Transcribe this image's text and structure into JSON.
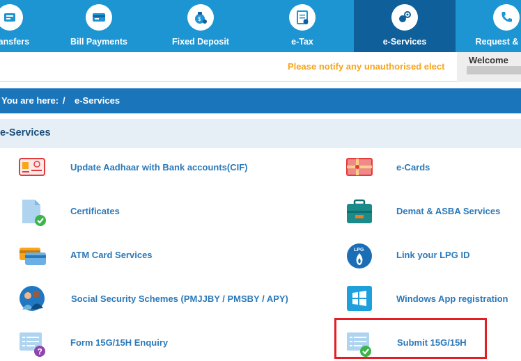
{
  "nav": {
    "items": [
      {
        "label": "Transfers"
      },
      {
        "label": "Bill Payments"
      },
      {
        "label": "Fixed Deposit"
      },
      {
        "label": "e-Tax"
      },
      {
        "label": "e-Services"
      },
      {
        "label": "Request & Enq"
      }
    ],
    "active": "e-Services",
    "colors": {
      "bar": "#1d95d2",
      "active": "#0f5f9b"
    }
  },
  "notice": {
    "text": "Please notify any unauthorised elect",
    "color": "#f7a51b"
  },
  "welcome": {
    "label": "Welcome"
  },
  "breadcrumb": {
    "prefix": "You are here:",
    "separator": "/",
    "current": "e-Services"
  },
  "section": {
    "title": "e-Services"
  },
  "services": {
    "left": [
      {
        "label": "Update Aadhaar with Bank accounts(CIF)",
        "icon": "aadhaar-card-icon"
      },
      {
        "label": "Certificates",
        "icon": "certificate-document-icon"
      },
      {
        "label": "ATM Card Services",
        "icon": "atm-cards-icon"
      },
      {
        "label": "Social Security Schemes (PMJJBY / PMSBY / APY)",
        "icon": "family-shield-icon"
      },
      {
        "label": "Form 15G/15H Enquiry",
        "icon": "form-question-icon"
      }
    ],
    "right": [
      {
        "label": "e-Cards",
        "icon": "gift-card-icon"
      },
      {
        "label": "Demat & ASBA Services",
        "icon": "briefcase-icon"
      },
      {
        "label": "Link your LPG ID",
        "icon": "lpg-flame-icon"
      },
      {
        "label": "Windows App registration",
        "icon": "windows-logo-icon"
      },
      {
        "label": "Submit 15G/15H",
        "icon": "form-check-icon"
      }
    ]
  },
  "highlight": {
    "target": "Submit 15G/15H",
    "color": "#e31e24"
  }
}
